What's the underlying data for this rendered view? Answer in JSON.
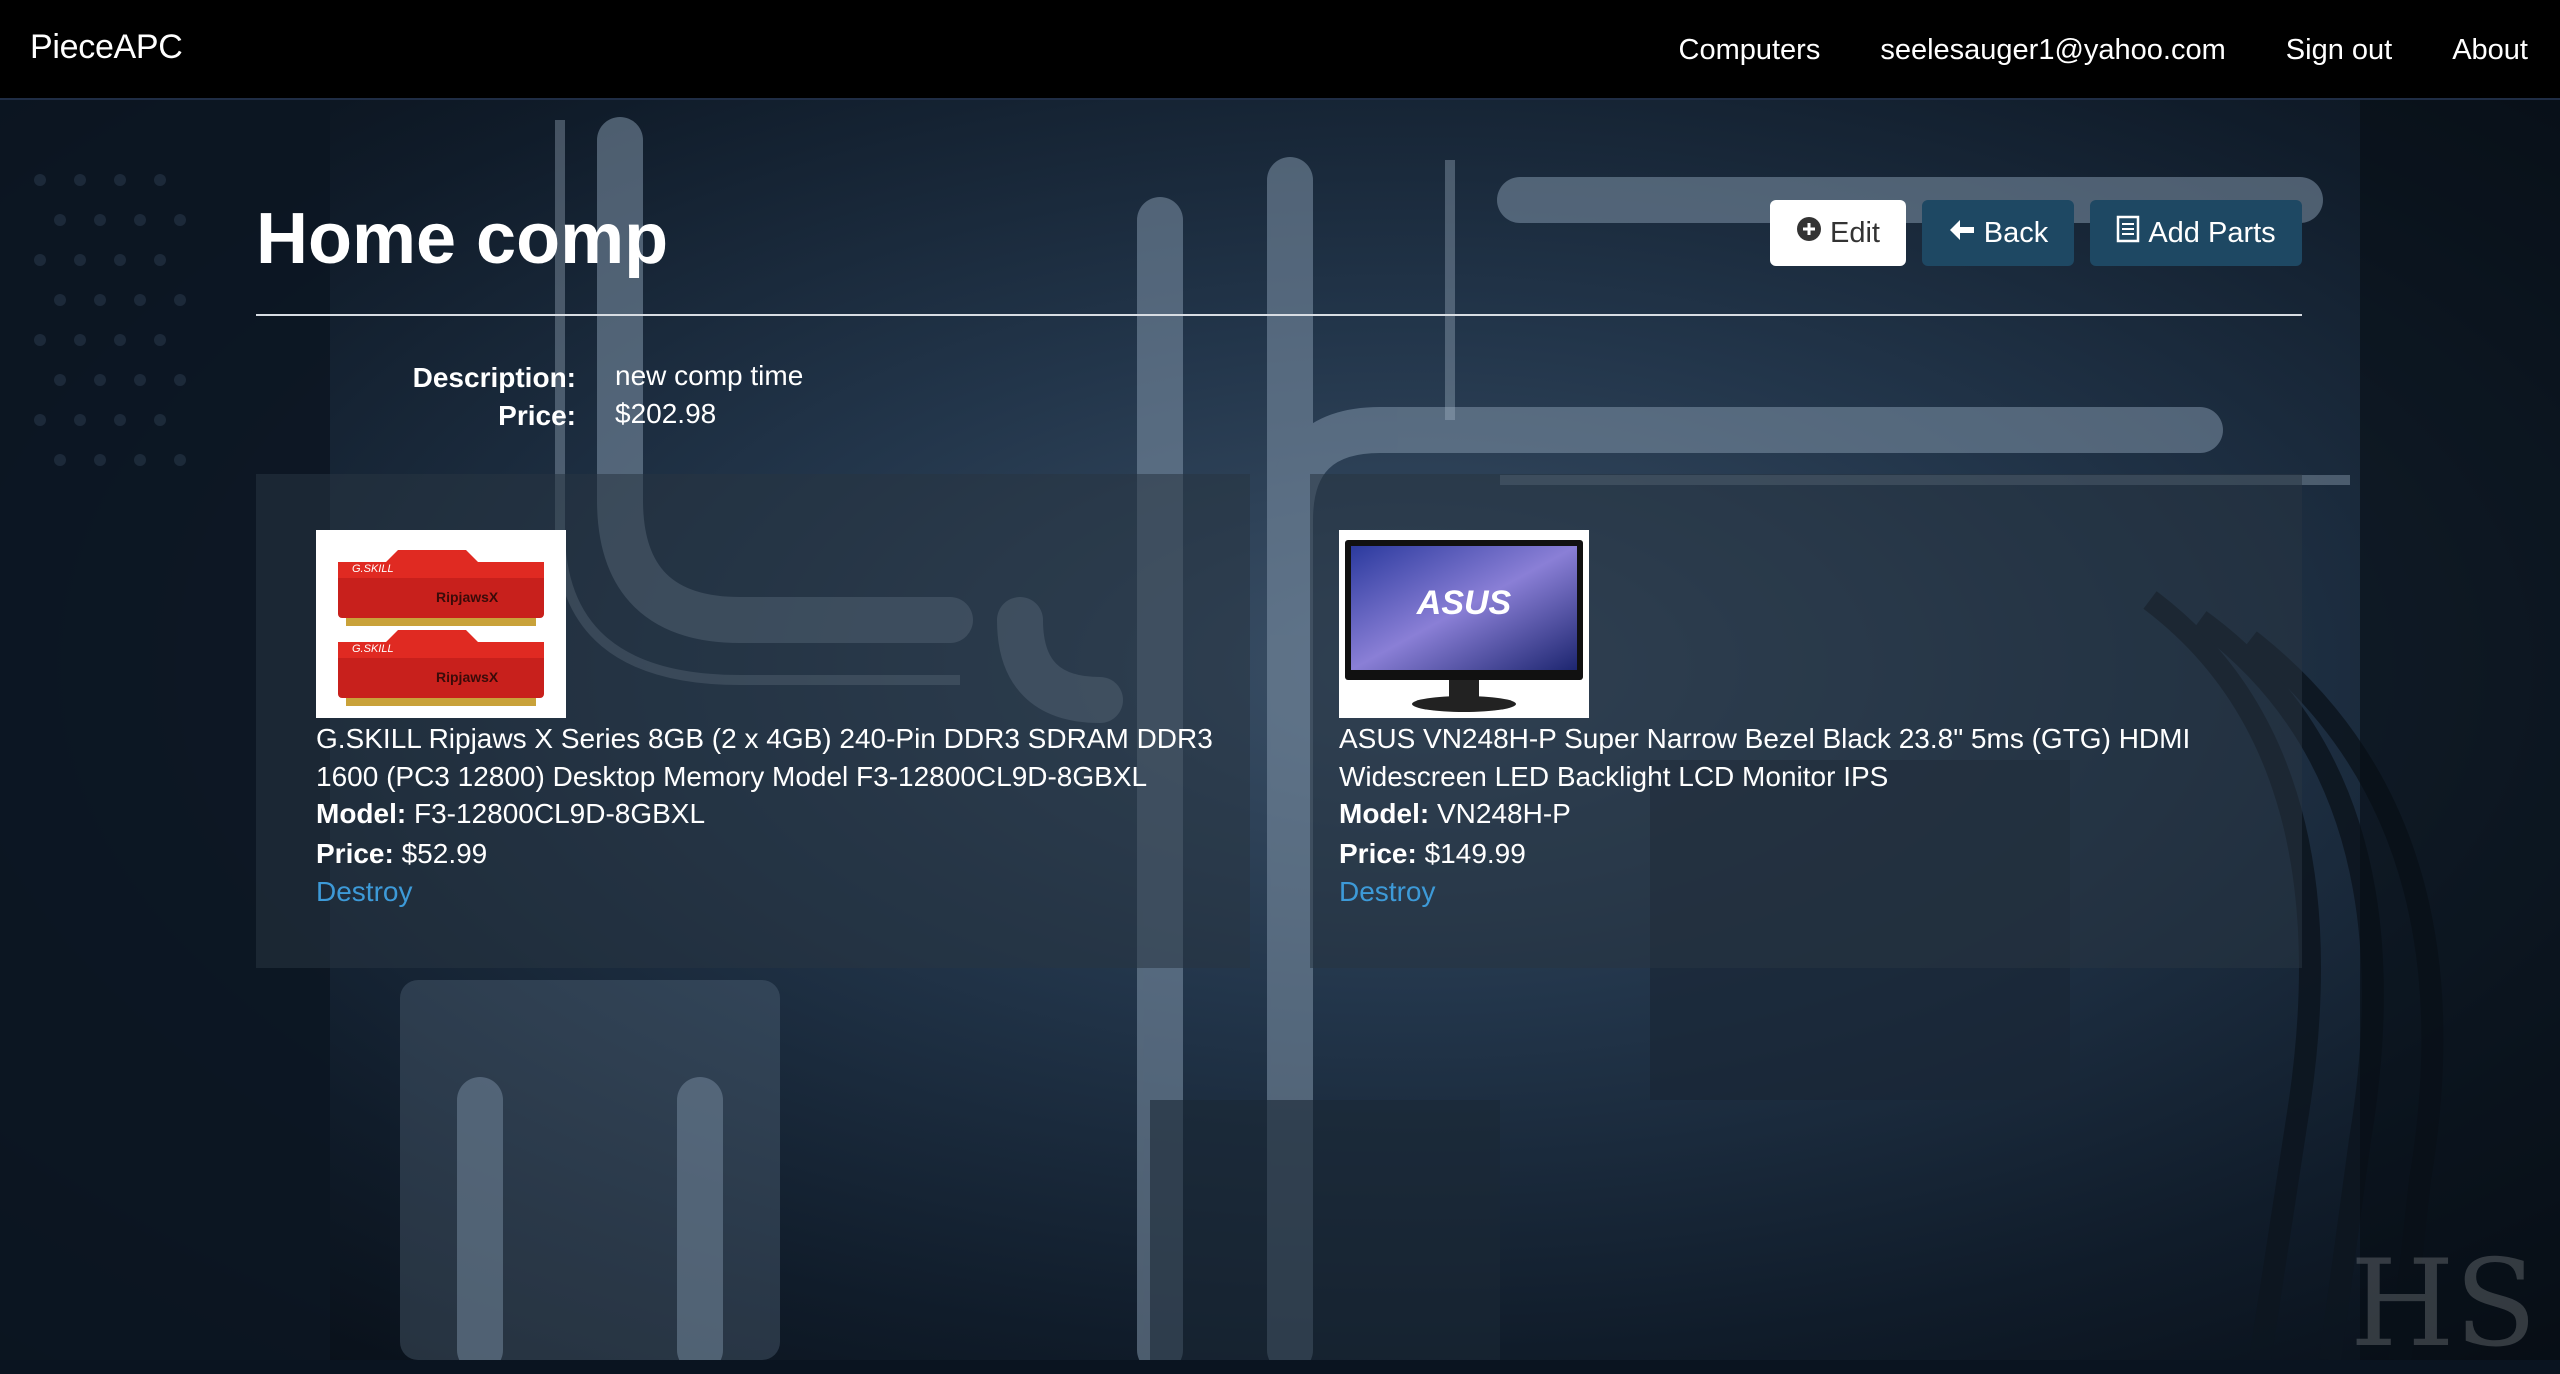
{
  "navbar": {
    "brand": "PieceAPC",
    "links": [
      "Computers",
      "seelesauger1@yahoo.com",
      "Sign out",
      "About"
    ]
  },
  "page": {
    "title": "Home comp",
    "buttons": {
      "edit": "Edit",
      "back": "Back",
      "add_parts": "Add Parts"
    }
  },
  "details": {
    "description_label": "Description:",
    "description_value": "new comp time",
    "price_label": "Price:",
    "price_value": "$202.98"
  },
  "parts": [
    {
      "image_icon": "ram-sticks-image",
      "title": "G.SKILL Ripjaws X Series 8GB (2 x 4GB) 240-Pin DDR3 SDRAM DDR3 1600 (PC3 12800) Desktop Memory Model F3-12800CL9D-8GBXL",
      "model_label": "Model:",
      "model_value": "F3-12800CL9D-8GBXL",
      "price_label": "Price:",
      "price_value": "$52.99",
      "action": "Destroy"
    },
    {
      "image_icon": "monitor-image",
      "title": "ASUS VN248H-P Super Narrow Bezel Black 23.8\" 5ms (GTG) HDMI Widescreen LED Backlight LCD Monitor IPS",
      "model_label": "Model:",
      "model_value": "VN248H-P",
      "price_label": "Price:",
      "price_value": "$149.99",
      "action": "Destroy"
    }
  ],
  "colors": {
    "navbar_bg": "#000000",
    "button_primary": "#1e4863",
    "link": "#3d9ad8"
  }
}
